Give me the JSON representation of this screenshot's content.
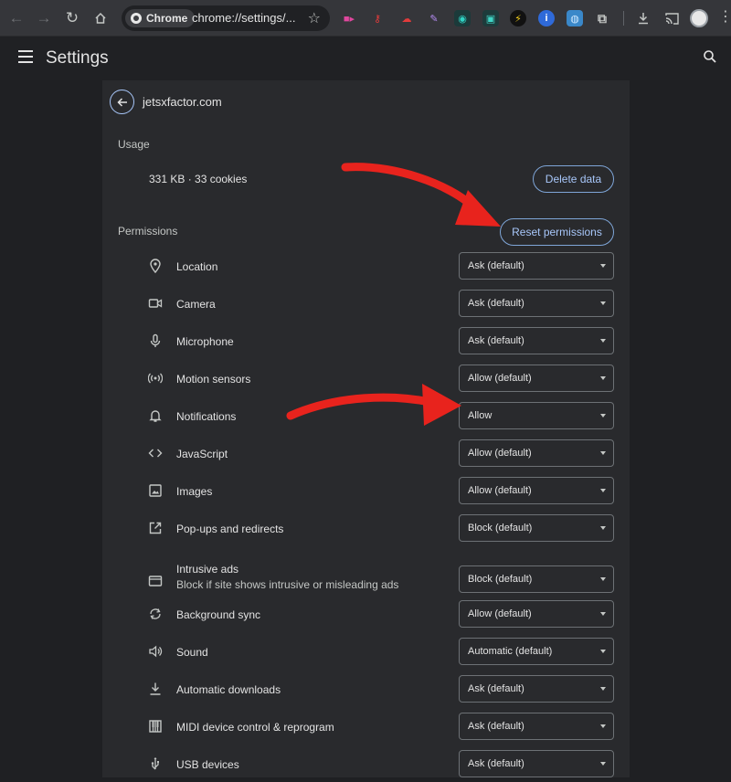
{
  "browser": {
    "chip_label": "Chrome",
    "url": "chrome://settings/..."
  },
  "appbar": {
    "title": "Settings"
  },
  "site": {
    "name": "jetsxfactor.com"
  },
  "usage": {
    "label": "Usage",
    "summary": "331 KB · 33 cookies",
    "delete_label": "Delete data"
  },
  "permissions": {
    "label": "Permissions",
    "reset_label": "Reset permissions",
    "items": [
      {
        "label": "Location",
        "value": "Ask (default)",
        "icon": "location-pin-icon"
      },
      {
        "label": "Camera",
        "value": "Ask (default)",
        "icon": "camera-icon"
      },
      {
        "label": "Microphone",
        "value": "Ask (default)",
        "icon": "microphone-icon"
      },
      {
        "label": "Motion sensors",
        "value": "Allow (default)",
        "icon": "sensors-icon"
      },
      {
        "label": "Notifications",
        "value": "Allow",
        "icon": "bell-icon"
      },
      {
        "label": "JavaScript",
        "value": "Allow (default)",
        "icon": "code-icon"
      },
      {
        "label": "Images",
        "value": "Allow (default)",
        "icon": "image-icon"
      },
      {
        "label": "Pop-ups and redirects",
        "value": "Block (default)",
        "icon": "open-in-new-icon"
      },
      {
        "label": "Intrusive ads",
        "sublabel": "Block if site shows intrusive or misleading ads",
        "value": "Block (default)",
        "icon": "ads-icon"
      },
      {
        "label": "Background sync",
        "value": "Allow (default)",
        "icon": "sync-icon"
      },
      {
        "label": "Sound",
        "value": "Automatic (default)",
        "icon": "volume-icon"
      },
      {
        "label": "Automatic downloads",
        "value": "Ask (default)",
        "icon": "download-icon"
      },
      {
        "label": "MIDI device control & reprogram",
        "value": "Ask (default)",
        "icon": "piano-icon"
      },
      {
        "label": "USB devices",
        "value": "Ask (default)",
        "icon": "usb-icon"
      }
    ]
  },
  "colors": {
    "accent": "#a8c7fa",
    "annotation_arrow": "#e8231d",
    "card_bg": "#292a2d",
    "page_bg": "#1f2023"
  }
}
